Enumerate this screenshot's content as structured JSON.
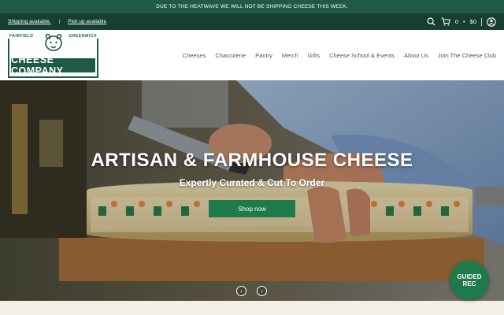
{
  "announcement": {
    "text": "DUE TO THE HEATWAVE WE WILL NOT BE SHIPPING CHEESE THIS WEEK."
  },
  "utility": {
    "shipping_link": "Shipping available.",
    "pickup_link": "Pick up available",
    "cart_count": "0",
    "cart_total": "$0"
  },
  "logo": {
    "town_left": "FAIRFIELD",
    "town_right": "GREENWICH",
    "name": "CHEESE COMPANY"
  },
  "nav": {
    "items": [
      {
        "label": "Cheeses"
      },
      {
        "label": "Charcuterie"
      },
      {
        "label": "Pantry"
      },
      {
        "label": "Merch"
      },
      {
        "label": "Gifts"
      },
      {
        "label": "Cheese School & Events"
      },
      {
        "label": "About Us"
      },
      {
        "label": "Join The Cheese Club"
      }
    ]
  },
  "hero": {
    "title": "ARTISAN & FARMHOUSE CHEESE",
    "subtitle": "Expertly Curated & Cut To Order",
    "cta": "Shop now",
    "prev_icon": "chevron-left-icon",
    "next_icon": "chevron-right-icon"
  },
  "guided_rec": {
    "line1": "GUIDED",
    "line2": "REC"
  },
  "colors": {
    "brand_green": "#1f5a45",
    "dark_green": "#143f31",
    "button_green": "#1f7a4b",
    "cream": "#f3efe4"
  }
}
